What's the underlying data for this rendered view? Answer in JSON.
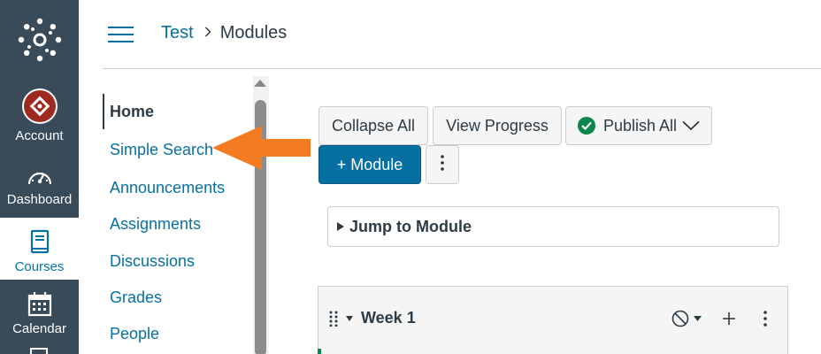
{
  "global_nav": {
    "items": [
      {
        "label": "Account",
        "icon": "account-avatar-icon"
      },
      {
        "label": "Dashboard",
        "icon": "dashboard-icon"
      },
      {
        "label": "Courses",
        "icon": "courses-icon"
      },
      {
        "label": "Calendar",
        "icon": "calendar-icon"
      }
    ],
    "active": "Courses"
  },
  "header": {
    "breadcrumb": [
      {
        "label": "Test"
      },
      {
        "label": "Modules"
      }
    ]
  },
  "course_nav": {
    "items": [
      {
        "label": "Home"
      },
      {
        "label": "Simple Search"
      },
      {
        "label": "Announcements"
      },
      {
        "label": "Assignments"
      },
      {
        "label": "Discussions"
      },
      {
        "label": "Grades"
      },
      {
        "label": "People"
      }
    ],
    "active": "Home"
  },
  "toolbar": {
    "collapse_all": "Collapse All",
    "view_progress": "View Progress",
    "publish_all": "Publish All",
    "add_module": "+ Module"
  },
  "jump_to_module": "Jump to Module",
  "modules": [
    {
      "title": "Week 1"
    }
  ],
  "colors": {
    "nav_bg": "#394b58",
    "link": "#0770a3",
    "primary_button": "#0770a3",
    "published_green": "#0b874b",
    "annotation_arrow": "#f47b20"
  }
}
